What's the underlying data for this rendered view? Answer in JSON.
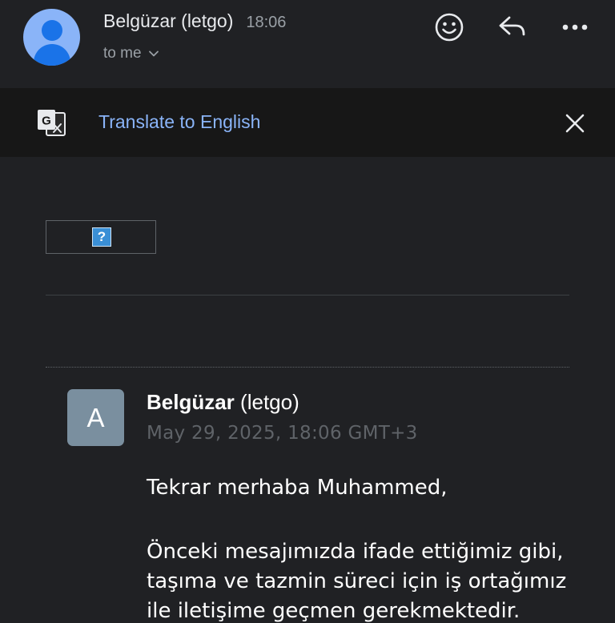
{
  "header": {
    "sender_name": "Belgüzar (letgo)",
    "time": "18:06",
    "recipient": "to me",
    "icons": [
      "smiley-icon",
      "reply-icon",
      "more-icon"
    ]
  },
  "translate_bar": {
    "link_label": "Translate to English",
    "icons": [
      "translate-icon",
      "close-icon"
    ]
  },
  "image_placeholder": {
    "glyph": "?"
  },
  "message": {
    "avatar_letter": "A",
    "from_name": "Belgüzar",
    "from_suffix": "(letgo)",
    "date": "May 29, 2025, 18:06 GMT+3",
    "greeting": "Tekrar merhaba Muhammed,",
    "para_lines": [
      "Önceki mesajımızda ifade ettiğimiz gibi,",
      "taşıma ve tazmin süreci için iş ortağımız",
      "ile iletişime geçmen gerekmektedir."
    ]
  },
  "colors": {
    "background": "#202124",
    "translate_bar": "#171717",
    "link": "#8ab4f8",
    "avatar": "#8ab4f8",
    "message_avatar": "#7a8f9f"
  }
}
